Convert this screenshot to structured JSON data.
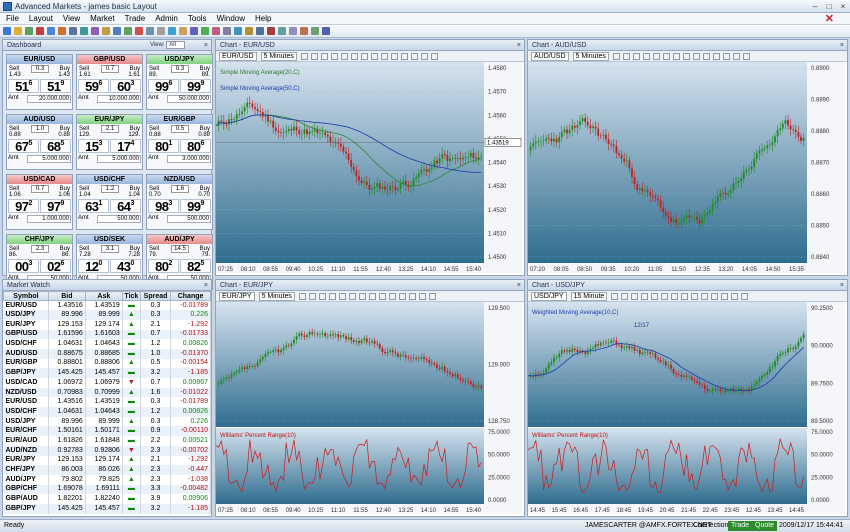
{
  "window": {
    "title": "Advanced Markets - james basic Layout",
    "min": "–",
    "max": "□",
    "close": "×"
  },
  "menu": [
    "File",
    "Layout",
    "View",
    "Market",
    "Trade",
    "Admin",
    "Tools",
    "Window",
    "Help"
  ],
  "dashboard": {
    "title": "Dashboard",
    "view_label": "View:",
    "view_value": "All",
    "tiles": [
      {
        "pair": "EUR/USD",
        "hc": "b",
        "sl": "Sell",
        "bl": "Buy",
        "sv": "1.43",
        "bv": "1.43",
        "spread": "0.3",
        "sbig": "51",
        "ssup": "6",
        "bbig": "51",
        "bsup": "9",
        "ft": "Amt",
        "amt": "20.000.000"
      },
      {
        "pair": "GBP/USD",
        "hc": "r",
        "sl": "Sell",
        "bl": "Buy",
        "sv": "1.61",
        "bv": "1.61",
        "spread": "0.7",
        "sbig": "59",
        "ssup": "6",
        "bbig": "60",
        "bsup": "3",
        "ft": "Amt",
        "amt": "10.000.000"
      },
      {
        "pair": "USD/JPY",
        "hc": "g",
        "sl": "Sell",
        "bl": "Buy",
        "sv": "89.",
        "bv": "89.",
        "spread": "0.3",
        "sbig": "99",
        "ssup": "6",
        "bbig": "99",
        "bsup": "9",
        "ft": "Amt",
        "amt": "50.000.000"
      },
      {
        "pair": "AUD/USD",
        "hc": "b",
        "sl": "Sell",
        "bl": "Buy",
        "sv": "0.88",
        "bv": "0.88",
        "spread": "1.0",
        "sbig": "67",
        "ssup": "5",
        "bbig": "68",
        "bsup": "5",
        "ft": "Amt",
        "amt": "5.000.000"
      },
      {
        "pair": "EUR/JPY",
        "hc": "g",
        "sl": "Sell",
        "bl": "Buy",
        "sv": "129.",
        "bv": "129.",
        "spread": "2.1",
        "sbig": "15",
        "ssup": "3",
        "bbig": "17",
        "bsup": "4",
        "ft": "Amt",
        "amt": "5.000.000"
      },
      {
        "pair": "EUR/GBP",
        "hc": "b",
        "sl": "Sell",
        "bl": "Buy",
        "sv": "0.88",
        "bv": "0.88",
        "spread": "0.5",
        "sbig": "80",
        "ssup": "1",
        "bbig": "80",
        "bsup": "6",
        "ft": "Amt",
        "amt": "3.000.000"
      },
      {
        "pair": "USD/CAD",
        "hc": "r",
        "sl": "Sell",
        "bl": "Buy",
        "sv": "1.06",
        "bv": "1.06",
        "spread": "0.7",
        "sbig": "97",
        "ssup": "2",
        "bbig": "97",
        "bsup": "9",
        "ft": "Amt",
        "amt": "1.000.000"
      },
      {
        "pair": "USD/CHF",
        "hc": "b",
        "sl": "Sell",
        "bl": "Buy",
        "sv": "1.04",
        "bv": "1.04",
        "spread": "1.2",
        "sbig": "63",
        "ssup": "1",
        "bbig": "64",
        "bsup": "3",
        "ft": "Amt",
        "amt": "500.000"
      },
      {
        "pair": "NZD/USD",
        "hc": "b",
        "sl": "Sell",
        "bl": "Buy",
        "sv": "0.70",
        "bv": "0.70",
        "spread": "1.6",
        "sbig": "98",
        "ssup": "3",
        "bbig": "99",
        "bsup": "9",
        "ft": "Amt",
        "amt": "500.000"
      },
      {
        "pair": "CHF/JPY",
        "hc": "g",
        "sl": "Sell",
        "bl": "Buy",
        "sv": "86.",
        "bv": "86.",
        "spread": "2.3",
        "sbig": "00",
        "ssup": "3",
        "bbig": "02",
        "bsup": "6",
        "ft": "Amt",
        "amt": "50.000"
      },
      {
        "pair": "USD/SEK",
        "hc": "b",
        "sl": "Sell",
        "bl": "Buy",
        "sv": "7.28",
        "bv": "7.28",
        "spread": "3.1",
        "sbig": "12",
        "ssup": "0",
        "bbig": "43",
        "bsup": "0",
        "ft": "Amt",
        "amt": "50.000"
      },
      {
        "pair": "AUD/JPY",
        "hc": "r",
        "sl": "Sell",
        "bl": "Buy",
        "sv": "79.",
        "bv": "79.",
        "spread": "14.5",
        "sbig": "80",
        "ssup": "2",
        "bbig": "82",
        "bsup": "5",
        "ft": "Amt",
        "amt": "50.000"
      }
    ]
  },
  "marketwatch": {
    "title": "Market Watch",
    "columns": [
      "Symbol",
      "Bid",
      "Ask",
      "Tick",
      "Spread",
      "Change"
    ],
    "rows": [
      [
        "EUR/USD",
        "1.43516",
        "1.43519",
        "eq",
        "0.3",
        "-0.01789"
      ],
      [
        "USD/JPY",
        "89.996",
        "89.999",
        "up",
        "0.3",
        "0.226"
      ],
      [
        "EUR/JPY",
        "129.153",
        "129.174",
        "up",
        "2.1",
        "-1.292"
      ],
      [
        "GBP/USD",
        "1.61596",
        "1.61603",
        "eq",
        "0.7",
        "-0.01733"
      ],
      [
        "USD/CHF",
        "1.04631",
        "1.04643",
        "eq",
        "1.2",
        "0.00826"
      ],
      [
        "AUD/USD",
        "0.88675",
        "0.88685",
        "eq",
        "1.0",
        "-0.01370"
      ],
      [
        "EUR/GBP",
        "0.88801",
        "0.88806",
        "up",
        "0.5",
        "-0.00154"
      ],
      [
        "GBP/JPY",
        "145.425",
        "145.457",
        "eq",
        "3.2",
        "-1.185"
      ],
      [
        "USD/CAD",
        "1.06972",
        "1.06979",
        "dn",
        "0.7",
        "0.00867"
      ],
      [
        "NZD/USD",
        "0.70983",
        "0.70999",
        "up",
        "1.6",
        "-0.01022"
      ],
      [
        "EUR/USD",
        "1.43516",
        "1.43519",
        "eq",
        "0.3",
        "-0.01789"
      ],
      [
        "USD/CHF",
        "1.04631",
        "1.04643",
        "eq",
        "1.2",
        "0.00826"
      ],
      [
        "USD/JPY",
        "89.996",
        "89.999",
        "up",
        "0.3",
        "0.226"
      ],
      [
        "EUR/CHF",
        "1.50161",
        "1.50171",
        "eq",
        "0.9",
        "-0.00110"
      ],
      [
        "EUR/AUD",
        "1.61826",
        "1.61848",
        "eq",
        "2.2",
        "0.00521"
      ],
      [
        "AUD/NZD",
        "0.92783",
        "0.92806",
        "dn",
        "2.3",
        "-0.00702"
      ],
      [
        "EUR/JPY",
        "129.153",
        "129.174",
        "up",
        "2.1",
        "-1.292"
      ],
      [
        "CHF/JPY",
        "86.003",
        "86.026",
        "up",
        "2.3",
        "-0.447"
      ],
      [
        "AUD/JPY",
        "79.802",
        "79.825",
        "up",
        "2.3",
        "-1.038"
      ],
      [
        "GBP/CHF",
        "1.69078",
        "1.69111",
        "eq",
        "3.3",
        "-0.00482"
      ],
      [
        "GBP/AUD",
        "1.82201",
        "1.82240",
        "eq",
        "3.9",
        "0.00906"
      ],
      [
        "GBP/JPY",
        "145.425",
        "145.457",
        "eq",
        "3.2",
        "-1.185"
      ]
    ]
  },
  "charts": [
    {
      "title": "Chart - EUR/USD",
      "symbol": "EUR/USD",
      "interval": "5 Minutes",
      "ind1": "Simple Moving Average(20,C)",
      "ind2": "Simple Moving Average(50,C)",
      "price_tag": "1.43519",
      "yticks": [
        "1.4580",
        "1.4570",
        "1.4560",
        "1.4550",
        "1.4540",
        "1.4530",
        "1.4520",
        "1.4510",
        "1.4500"
      ],
      "xticks": [
        "07:25",
        "08:10",
        "08:55",
        "09:40",
        "10:25",
        "11:10",
        "11:55",
        "12:40",
        "13:25",
        "14:10",
        "14:55",
        "15:40"
      ]
    },
    {
      "title": "Chart - AUD/USD",
      "symbol": "AUD/USD",
      "interval": "5 Minutes",
      "yticks": [
        "0.8900",
        "0.8890",
        "0.8880",
        "0.8870",
        "0.8860",
        "0.8850",
        "0.8840"
      ],
      "xticks": [
        "07:20",
        "08:05",
        "08:50",
        "09:35",
        "10:20",
        "11:05",
        "11:50",
        "12:35",
        "13:20",
        "14:05",
        "14:50",
        "15:35"
      ]
    },
    {
      "title": "Chart - EUR/JPY",
      "symbol": "EUR/JPY",
      "interval": "5 Minutes",
      "ind1": "Williams' Percent Range(10)",
      "yticks": [
        "129.500",
        "129.000",
        "128.750"
      ],
      "oticks": [
        "75.0000",
        "50.0000",
        "25.0000",
        "0.0000"
      ],
      "xticks": [
        "07:25",
        "08:10",
        "08:55",
        "09:40",
        "10:25",
        "11:10",
        "11:55",
        "12:40",
        "13:25",
        "14:10",
        "14:55",
        "15:40"
      ]
    },
    {
      "title": "Chart - USD/JPY",
      "symbol": "USD/JPY",
      "interval": "15 Minute",
      "ind1": "Weighted Moving Average(10,C)",
      "ind2": "Williams' Percent Range(10)",
      "date_label": "12/17",
      "yticks": [
        "90.2500",
        "90.0000",
        "89.7500",
        "89.5000"
      ],
      "oticks": [
        "75.0000",
        "50.0000",
        "25.0000",
        "0.0000"
      ],
      "xticks": [
        "14:45",
        "15:45",
        "16:45",
        "17:45",
        "18:45",
        "19:45",
        "20:45",
        "21:45",
        "22:45",
        "23:45",
        "12:45",
        "13:45",
        "14:45"
      ]
    }
  ],
  "status": {
    "ready": "Ready",
    "account": "JAMESCARTER @AMFX.FORTEX.NET",
    "connections": "Connections:",
    "trade": "Trade",
    "quote": "Quote",
    "time": "2009/12/17 15:44:41"
  },
  "colors": {
    "up": "#0a8a0a",
    "down": "#c01010",
    "chart_bg_top": "#d6e3ef",
    "chart_bg_bottom": "#2e6c8e"
  }
}
